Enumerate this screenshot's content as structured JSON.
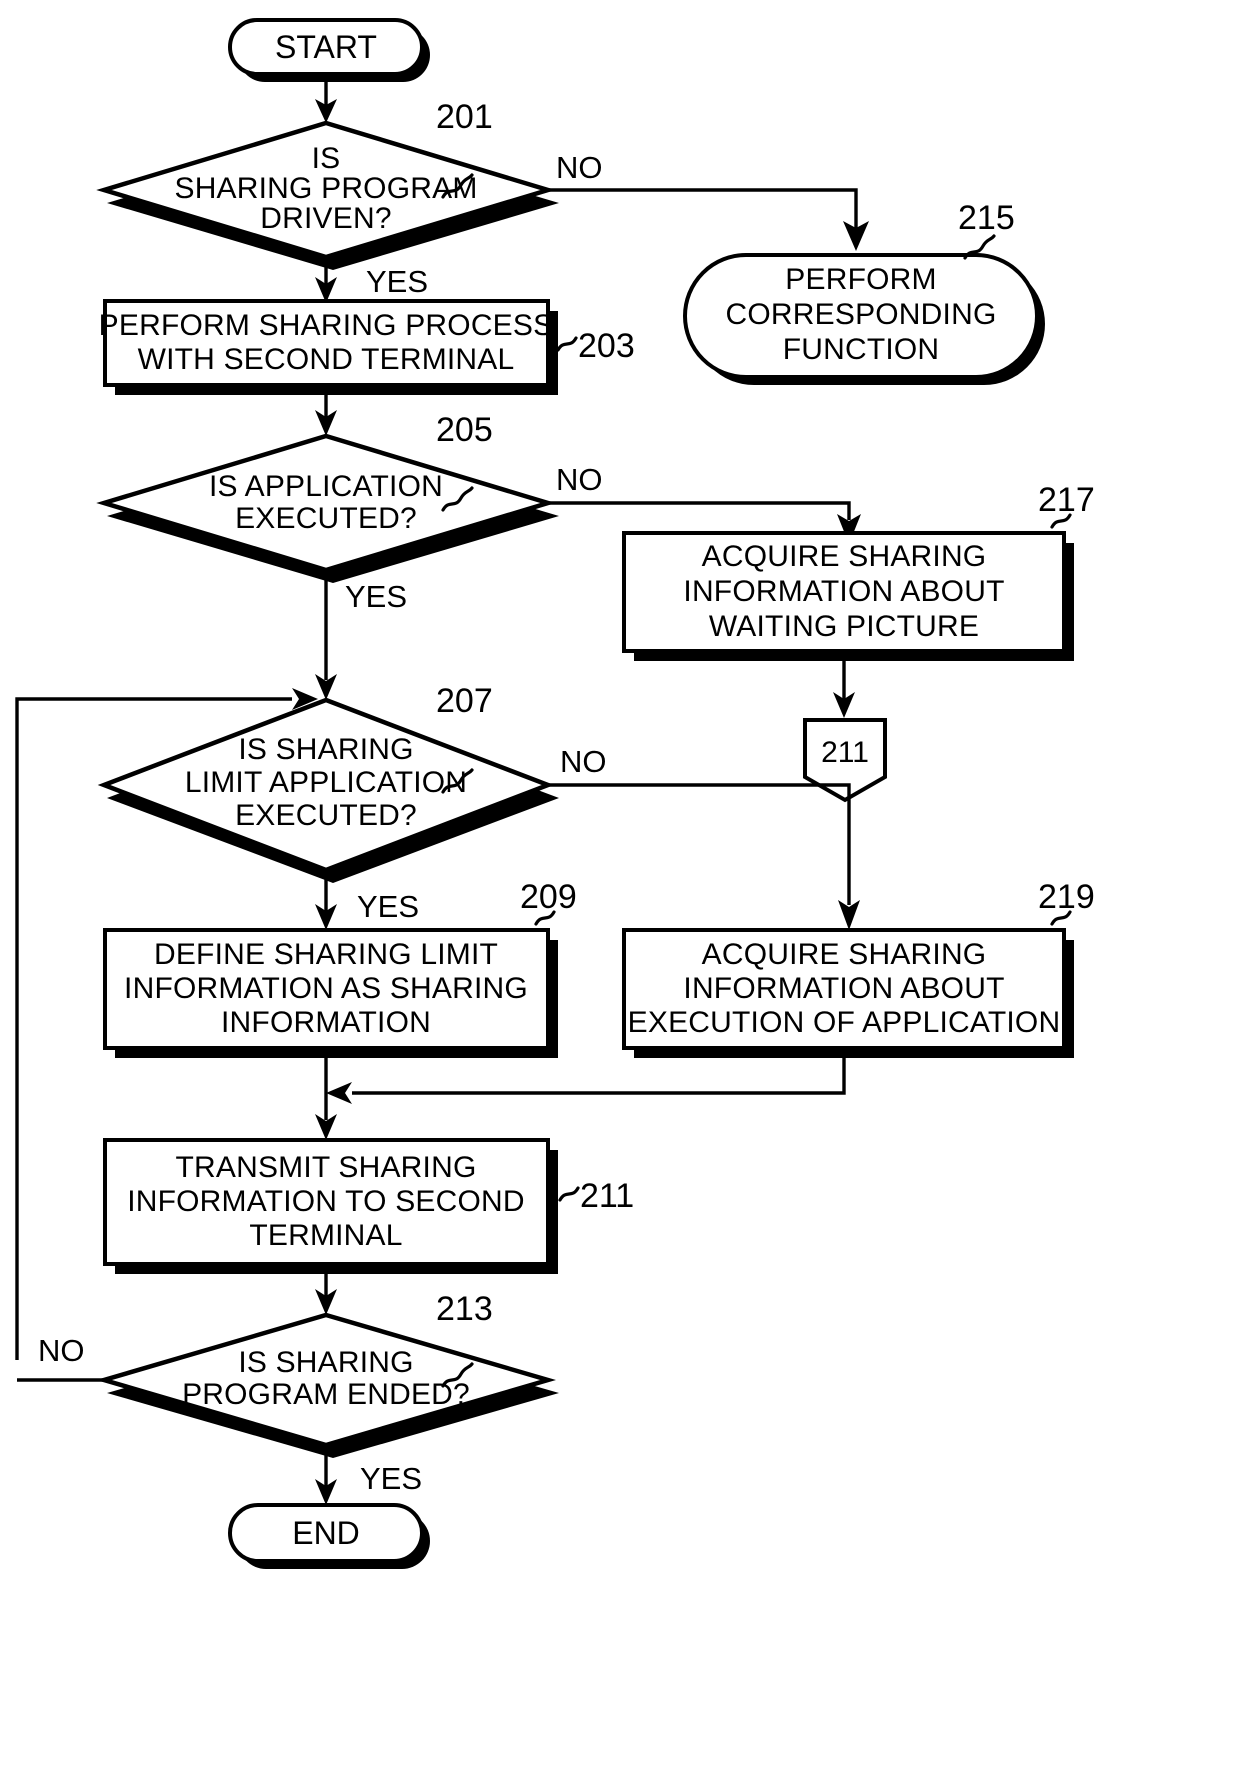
{
  "diagram": {
    "type": "flowchart",
    "title": "",
    "terminators": {
      "start": "START",
      "end": "END"
    },
    "nodes": [
      {
        "id": "201",
        "shape": "decision",
        "ref": "201",
        "lines": [
          "IS",
          "SHARING PROGRAM",
          "DRIVEN?"
        ]
      },
      {
        "id": "203",
        "shape": "process",
        "ref": "203",
        "lines": [
          "PERFORM SHARING PROCESS",
          "WITH SECOND TERMINAL"
        ]
      },
      {
        "id": "205",
        "shape": "decision",
        "ref": "205",
        "lines": [
          "IS APPLICATION",
          "EXECUTED?"
        ]
      },
      {
        "id": "207",
        "shape": "decision",
        "ref": "207",
        "lines": [
          "IS SHARING",
          "LIMIT APPLICATION",
          "EXECUTED?"
        ]
      },
      {
        "id": "209",
        "shape": "process",
        "ref": "209",
        "lines": [
          "DEFINE SHARING LIMIT",
          "INFORMATION AS SHARING",
          "INFORMATION"
        ]
      },
      {
        "id": "211",
        "shape": "process",
        "ref": "211",
        "lines": [
          "TRANSMIT SHARING",
          "INFORMATION TO SECOND",
          "TERMINAL"
        ]
      },
      {
        "id": "213",
        "shape": "decision",
        "ref": "213",
        "lines": [
          "IS SHARING",
          "PROGRAM ENDED?"
        ]
      },
      {
        "id": "215",
        "shape": "terminator",
        "ref": "215",
        "lines": [
          "PERFORM",
          "CORRESPONDING",
          "FUNCTION"
        ]
      },
      {
        "id": "217",
        "shape": "process",
        "ref": "217",
        "lines": [
          "ACQUIRE SHARING",
          "INFORMATION ABOUT",
          "WAITING PICTURE"
        ]
      },
      {
        "id": "219",
        "shape": "process",
        "ref": "219",
        "lines": [
          "ACQUIRE SHARING",
          "INFORMATION ABOUT",
          "EXECUTION OF APPLICATION"
        ]
      }
    ],
    "offpage_connector": {
      "ref": "211",
      "label": "211"
    },
    "branch_labels": {
      "d201_no": "NO",
      "d201_yes": "YES",
      "d205_no": "NO",
      "d205_yes": "YES",
      "d207_no": "NO",
      "d207_yes": "YES",
      "d213_no": "NO",
      "d213_yes": "YES"
    },
    "reference_numerals": {
      "n201": "201",
      "n203": "203",
      "n205": "205",
      "n207": "207",
      "n209": "209",
      "n211": "211",
      "n213": "213",
      "n215": "215",
      "n217": "217",
      "n219": "219"
    },
    "colors": {
      "stroke": "#000000",
      "fill": "#ffffff",
      "background": "#ffffff"
    }
  }
}
